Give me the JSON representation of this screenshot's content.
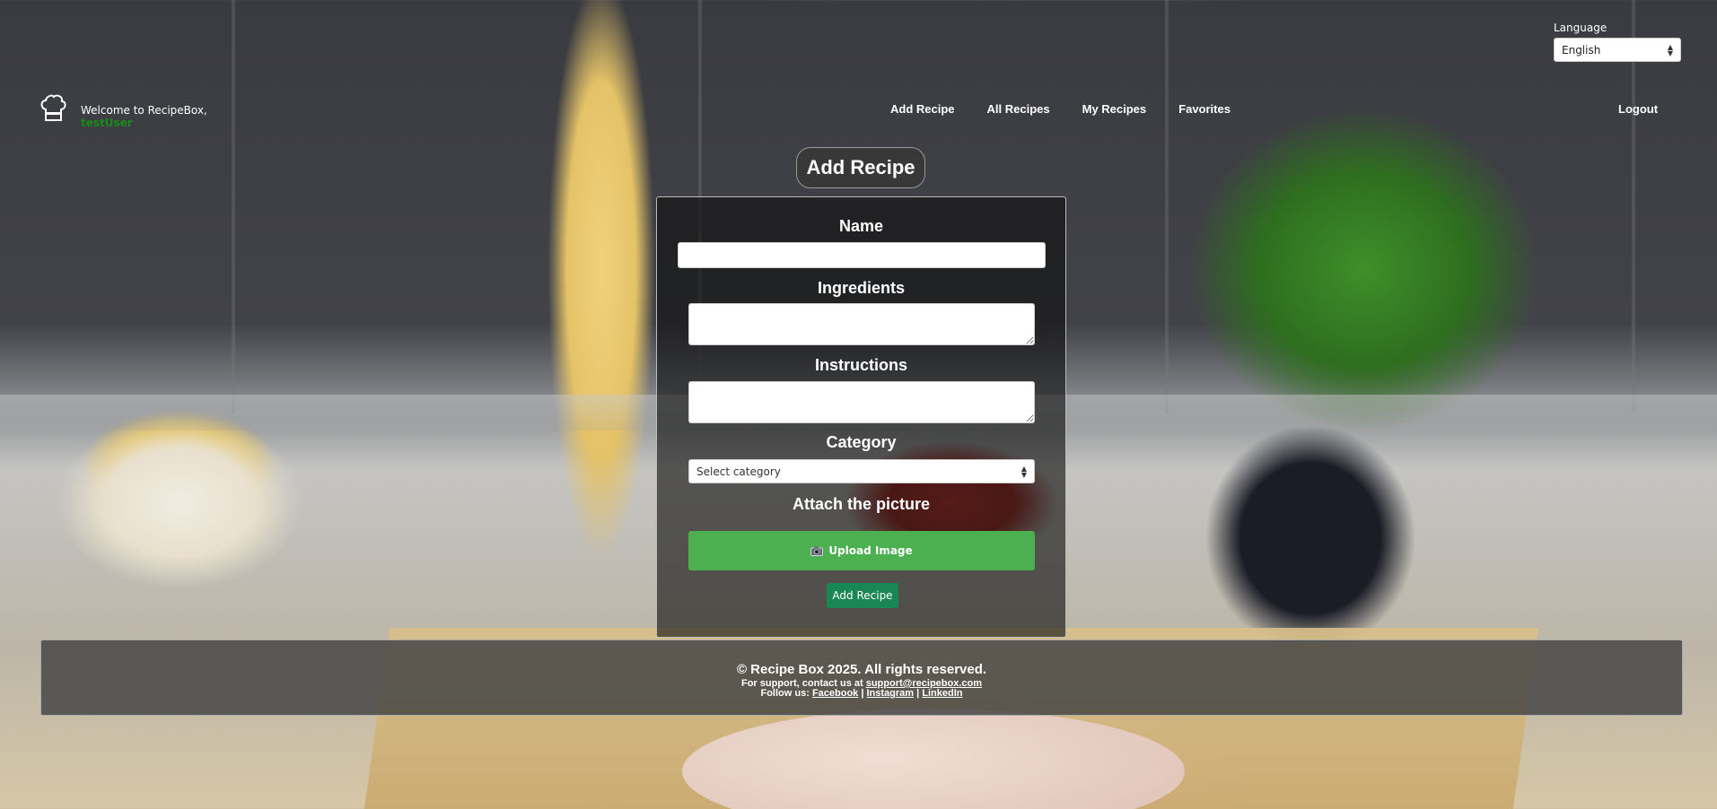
{
  "header": {
    "welcome_text": "Welcome to RecipeBox,",
    "username": "testUser",
    "nav": {
      "add_recipe": "Add Recipe",
      "all_recipes": "All Recipes",
      "my_recipes": "My Recipes",
      "favorites": "Favorites"
    },
    "logout": "Logout",
    "language": {
      "label": "Language",
      "selected": "English"
    }
  },
  "form": {
    "title": "Add Recipe",
    "name_label": "Name",
    "name_value": "",
    "ingredients_label": "Ingredients",
    "ingredients_value": "",
    "instructions_label": "Instructions",
    "instructions_value": "",
    "category_label": "Category",
    "category_selected": "Select category",
    "picture_label": "Attach the picture",
    "upload_label": "Upload Image",
    "submit_label": "Add Recipe"
  },
  "footer": {
    "copyright": "© Recipe Box 2025. All rights reserved.",
    "support_prefix": "For support, contact us at",
    "support_email": "support@recipebox.com",
    "follow_prefix": "Follow us:",
    "facebook": "Facebook",
    "separator": "|",
    "instagram": "Instagram",
    "linkedin": "LinkedIn"
  },
  "icons": {
    "brand": "chef-hat-icon",
    "upload": "camera-icon",
    "select_arrows": "updown-arrows-icon"
  },
  "colors": {
    "upload_button": "#4caf50",
    "submit_button": "#198754",
    "username": "#1a8a1a"
  }
}
